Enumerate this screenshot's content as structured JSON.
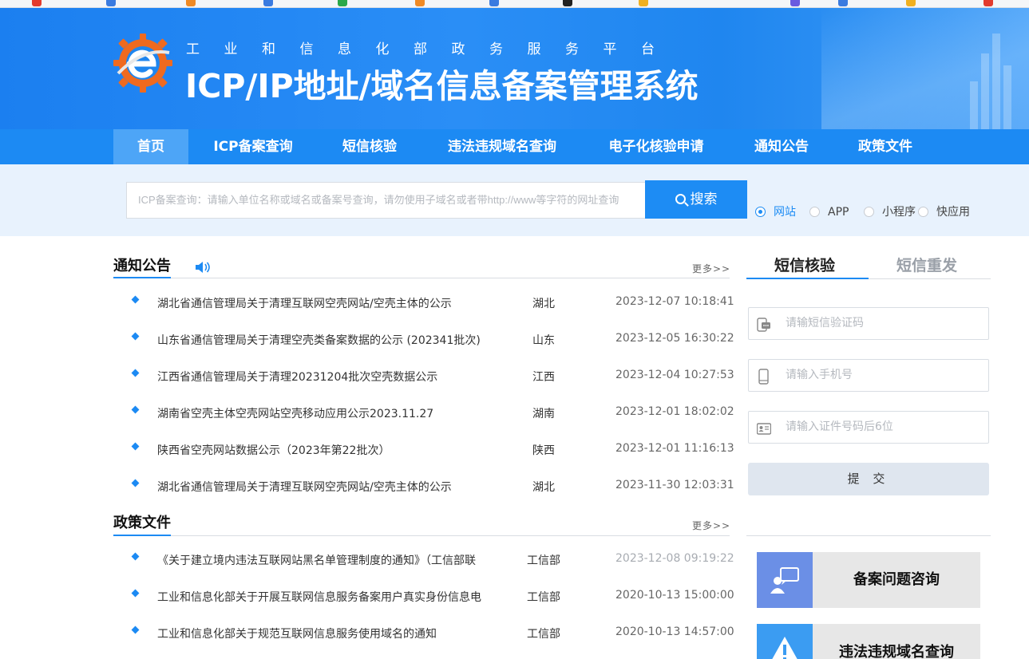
{
  "header": {
    "subtitle": "工业和信息化部政务服务平台",
    "title": "ICP/IP地址/域名信息备案管理系统"
  },
  "nav": {
    "items": [
      {
        "label": "首页",
        "active": true
      },
      {
        "label": "ICP备案查询"
      },
      {
        "label": "短信核验"
      },
      {
        "label": "违法违规域名查询"
      },
      {
        "label": "电子化核验申请"
      },
      {
        "label": "通知公告"
      },
      {
        "label": "政策文件"
      }
    ]
  },
  "search": {
    "placeholder": "ICP备案查询：请输入单位名称或域名或备案号查询，请勿使用子域名或者带http://www等字符的网址查询",
    "button_label": "搜索",
    "options": [
      {
        "label": "网站",
        "selected": true
      },
      {
        "label": "APP"
      },
      {
        "label": "小程序"
      },
      {
        "label": "快应用"
      }
    ]
  },
  "notices": {
    "title": "通知公告",
    "more": "更多>>",
    "items": [
      {
        "title": "湖北省通信管理局关于清理互联网空壳网站/空壳主体的公示",
        "province": "湖北",
        "date": "2023-12-07 10:18:41"
      },
      {
        "title": "山东省通信管理局关于清理空壳类备案数据的公示 (202341批次)",
        "province": "山东",
        "date": "2023-12-05 16:30:22"
      },
      {
        "title": "江西省通信管理局关于清理20231204批次空壳数据公示",
        "province": "江西",
        "date": "2023-12-04 10:27:53"
      },
      {
        "title": "湖南省空壳主体空壳网站空壳移动应用公示2023.11.27",
        "province": "湖南",
        "date": "2023-12-01 18:02:02"
      },
      {
        "title": "陕西省空壳网站数据公示（2023年第22批次）",
        "province": "陕西",
        "date": "2023-12-01 11:16:13"
      },
      {
        "title": "湖北省通信管理局关于清理互联网空壳网站/空壳主体的公示",
        "province": "湖北",
        "date": "2023-11-30 12:03:31"
      }
    ]
  },
  "policies": {
    "title": "政策文件",
    "more": "更多>>",
    "items": [
      {
        "title": "《关于建立境内违法互联网站黑名单管理制度的通知》（工信部联",
        "source": "工信部",
        "date": "2023-12-08 09:19:22"
      },
      {
        "title": "工业和信息化部关于开展互联网信息服务备案用户真实身份信息电",
        "source": "工信部",
        "date": "2020-10-13 15:00:00"
      },
      {
        "title": "工业和信息化部关于规范互联网信息服务使用域名的通知",
        "source": "工信部",
        "date": "2020-10-13 14:57:00"
      }
    ]
  },
  "sms": {
    "tab_verify": "短信核验",
    "tab_resend": "短信重发",
    "code_placeholder": "请输短信验证码",
    "phone_placeholder": "请输入手机号",
    "id_placeholder": "请输入证件号码后6位",
    "submit_label": "提 交"
  },
  "cards": [
    {
      "label": "备案问题咨询",
      "icon": "consult-icon",
      "color": "#6b8fe6"
    },
    {
      "label": "违法违规域名查询",
      "icon": "warning-icon",
      "color": "#3b9cf2"
    }
  ],
  "colors": {
    "primary": "#1c8af3",
    "nav_active": "#4da5f7",
    "search_band": "#e8f2fd"
  }
}
